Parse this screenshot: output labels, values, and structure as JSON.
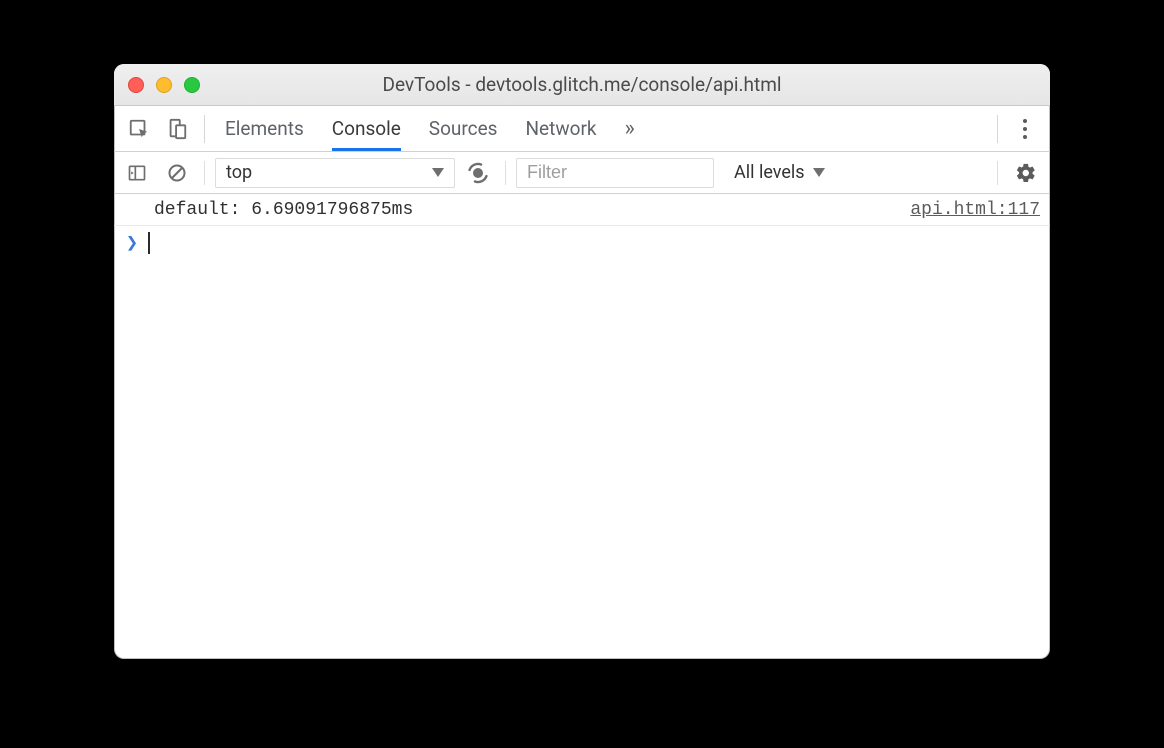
{
  "window": {
    "title": "DevTools - devtools.glitch.me/console/api.html"
  },
  "tabs": {
    "items": [
      "Elements",
      "Console",
      "Sources",
      "Network"
    ],
    "active": "Console",
    "overflow_glyph": "»"
  },
  "filterbar": {
    "context": "top",
    "filter_placeholder": "Filter",
    "levels_label": "All levels"
  },
  "console": {
    "rows": [
      {
        "message": "default: 6.69091796875ms",
        "source": "api.html:117"
      }
    ],
    "prompt_glyph": "❯"
  }
}
